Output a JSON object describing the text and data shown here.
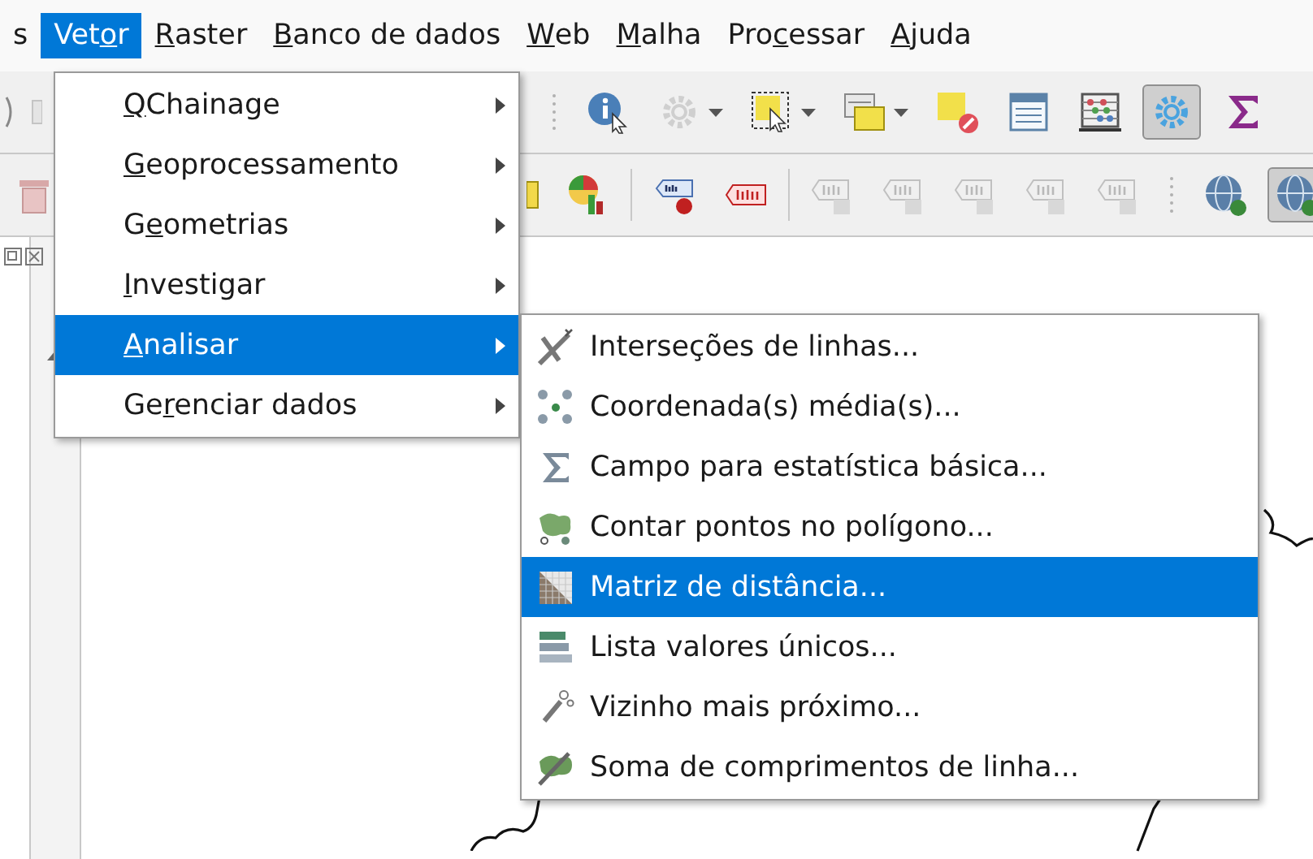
{
  "menubar": [
    {
      "label": {
        "pre": "s"
      },
      "selected": false
    },
    {
      "label": {
        "pre": "Vet",
        "key": "o",
        "post": "r"
      },
      "selected": true
    },
    {
      "label": {
        "key": "R",
        "post": "aster"
      },
      "selected": false
    },
    {
      "label": {
        "key": "B",
        "post": "anco de dados"
      },
      "selected": false
    },
    {
      "label": {
        "key": "W",
        "post": "eb"
      },
      "selected": false
    },
    {
      "label": {
        "key": "M",
        "post": "alha"
      },
      "selected": false
    },
    {
      "label": {
        "pre": "Pro",
        "key": "c",
        "post": "essar"
      },
      "selected": false
    },
    {
      "label": {
        "key": "A",
        "post": "juda"
      },
      "selected": false
    }
  ],
  "toolbar_1": [
    {
      "kind": "grip",
      "pressed": false,
      "dropdown": false
    },
    {
      "kind": "identify",
      "pressed": false,
      "dropdown": false
    },
    {
      "kind": "gear-disabled",
      "pressed": false,
      "dropdown": true
    },
    {
      "kind": "select",
      "pressed": false,
      "dropdown": true
    },
    {
      "kind": "layers",
      "pressed": false,
      "dropdown": true
    },
    {
      "kind": "deselect",
      "pressed": false,
      "dropdown": false
    },
    {
      "kind": "table",
      "pressed": false,
      "dropdown": false
    },
    {
      "kind": "abacus",
      "pressed": false,
      "dropdown": false
    },
    {
      "kind": "gear",
      "pressed": true,
      "dropdown": false
    },
    {
      "kind": "sigma",
      "pressed": false,
      "dropdown": false
    }
  ],
  "toolbar_2": [
    {
      "kind": "edge",
      "pressed": false,
      "dropdown": false
    },
    {
      "kind": "pie",
      "pressed": false,
      "dropdown": false
    },
    {
      "kind": "separator"
    },
    {
      "kind": "label-pin",
      "pressed": false,
      "dropdown": false
    },
    {
      "kind": "label-red",
      "pressed": false,
      "dropdown": false
    },
    {
      "kind": "separator"
    },
    {
      "kind": "label-grey",
      "pressed": false,
      "dropdown": false
    },
    {
      "kind": "label-grey",
      "pressed": false,
      "dropdown": false
    },
    {
      "kind": "label-grey",
      "pressed": false,
      "dropdown": false
    },
    {
      "kind": "label-grey",
      "pressed": false,
      "dropdown": false
    },
    {
      "kind": "label-grey",
      "pressed": false,
      "dropdown": false
    },
    {
      "kind": "grip",
      "pressed": false,
      "dropdown": false
    },
    {
      "kind": "globe",
      "pressed": false,
      "dropdown": false
    },
    {
      "kind": "globe",
      "pressed": true,
      "dropdown": false
    }
  ],
  "menu": [
    {
      "label": {
        "key": "Q",
        "post": "Chainage"
      },
      "selected": false,
      "has_submenu": true
    },
    {
      "label": {
        "key": "G",
        "post": "eoprocessamento"
      },
      "selected": false,
      "has_submenu": true
    },
    {
      "label": {
        "pre": "G",
        "key": "e",
        "post": "ometrias"
      },
      "selected": false,
      "has_submenu": true
    },
    {
      "label": {
        "key": "I",
        "post": "nvestigar"
      },
      "selected": false,
      "has_submenu": true
    },
    {
      "label": {
        "key": "A",
        "post": "nalisar"
      },
      "selected": true,
      "has_submenu": true
    },
    {
      "label": {
        "pre": "Ge",
        "key": "r",
        "post": "enciar dados"
      },
      "selected": false,
      "has_submenu": true
    }
  ],
  "submenu": [
    {
      "kind": "line-intersections",
      "label": "Interseções de linhas...",
      "selected": false
    },
    {
      "kind": "mean-coordinates",
      "label": "Coordenada(s) média(s)...",
      "selected": false
    },
    {
      "kind": "statistics",
      "label": "Campo para estatística básica...",
      "selected": false
    },
    {
      "kind": "count-points",
      "label": "Contar pontos no polígono...",
      "selected": false
    },
    {
      "kind": "distance-matrix",
      "label": "Matriz de distância...",
      "selected": true
    },
    {
      "kind": "unique-values",
      "label": "Lista valores únicos...",
      "selected": false
    },
    {
      "kind": "nearest-neighbour",
      "label": "Vizinho mais próximo...",
      "selected": false
    },
    {
      "kind": "line-lengths",
      "label": "Soma de comprimentos de linha...",
      "selected": false
    }
  ]
}
